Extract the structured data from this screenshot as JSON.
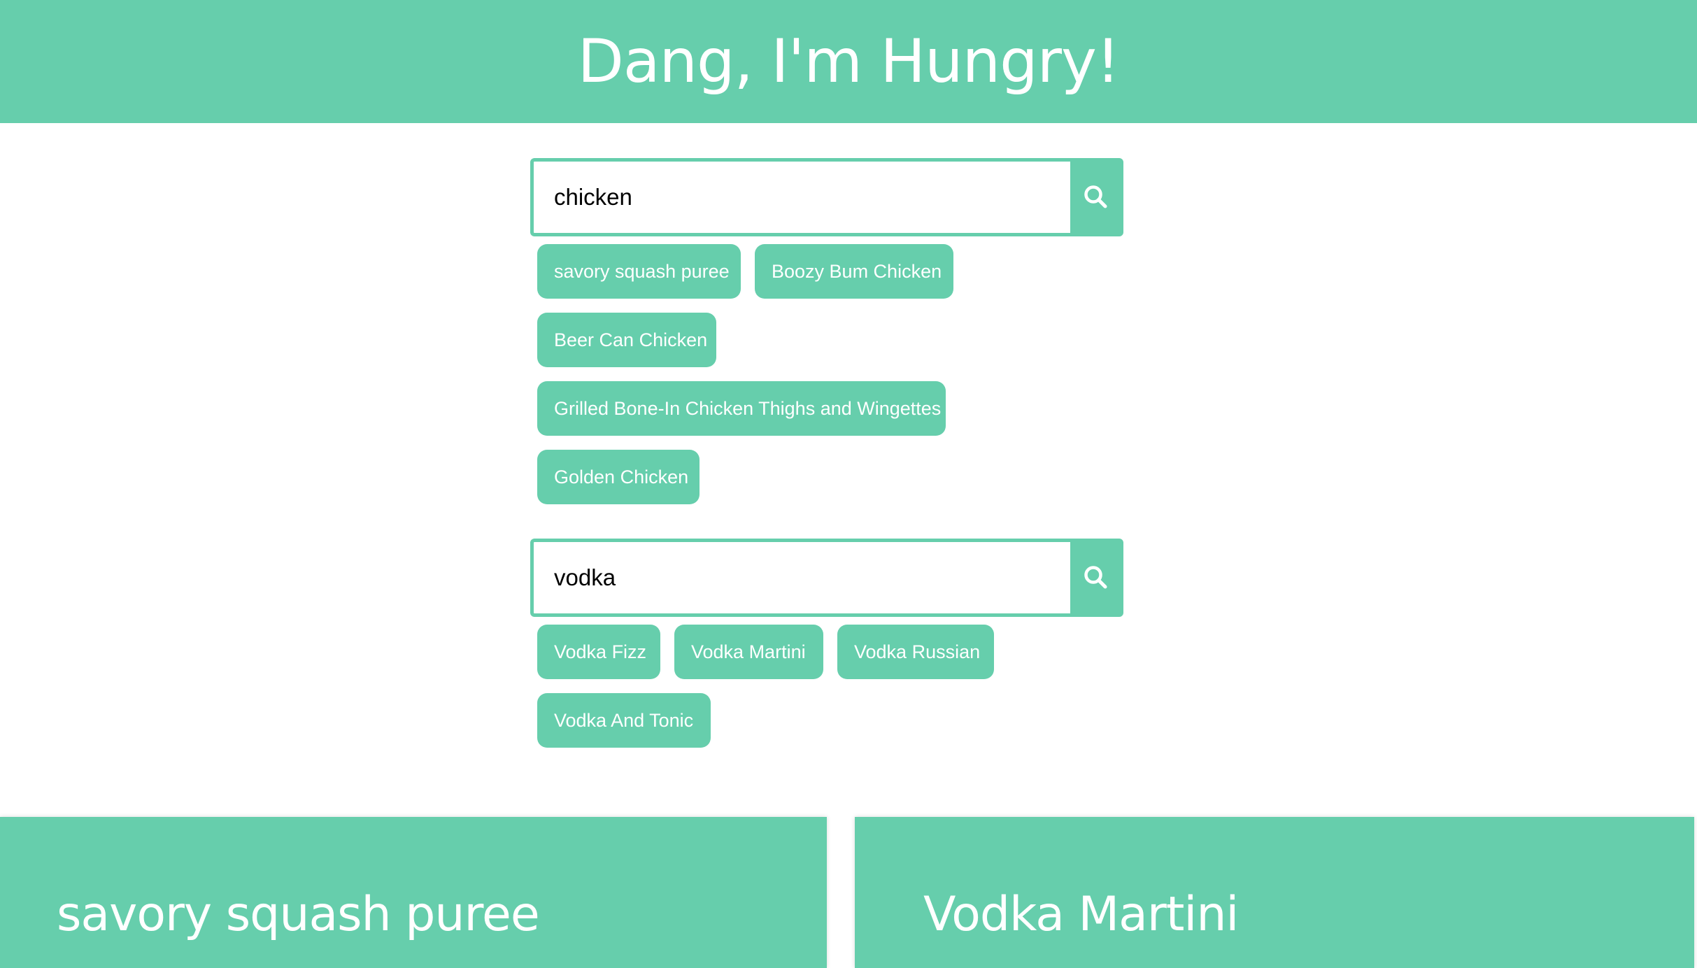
{
  "header": {
    "title": "Dang, I'm Hungry!"
  },
  "food_search": {
    "value": "chicken",
    "icon": "search-icon",
    "results": [
      "savory squash puree",
      "Boozy Bum Chicken",
      "Beer Can Chicken",
      "Grilled Bone-In Chicken Thighs and Wingettes",
      "Golden Chicken"
    ]
  },
  "drink_search": {
    "value": "vodka",
    "icon": "search-icon",
    "results": [
      "Vodka Fizz",
      "Vodka Martini",
      "Vodka Russian",
      "Vodka And Tonic"
    ]
  },
  "cards": {
    "food_title": "savory squash puree",
    "drink_title": "Vodka Martini"
  },
  "colors": {
    "accent": "#66ceac",
    "text_on_accent": "#ffffff"
  }
}
